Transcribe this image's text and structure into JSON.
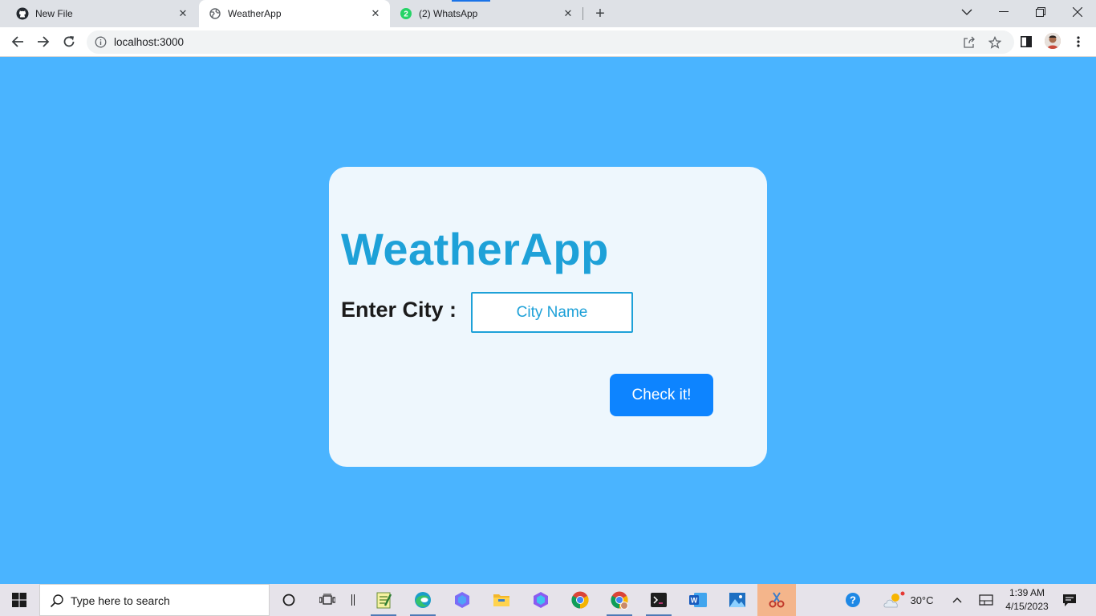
{
  "browser": {
    "tabs": [
      {
        "label": "New File",
        "icon": "github-icon"
      },
      {
        "label": "WeatherApp",
        "icon": "globe-icon",
        "active": true
      },
      {
        "label": "(2) WhatsApp",
        "icon": "whatsapp-icon",
        "badge": "2"
      }
    ],
    "url": "localhost:3000"
  },
  "app": {
    "title": "WeatherApp",
    "city_label": "Enter City :",
    "city_placeholder": "City Name",
    "button_label": "Check it!"
  },
  "taskbar": {
    "search_placeholder": "Type here to search",
    "weather_temp": "30°C",
    "time": "1:39 AM",
    "date": "4/15/2023"
  },
  "colors": {
    "page_bg": "#4ab4ff",
    "card_bg": "#eef7fd",
    "title": "#1ea1d8",
    "button": "#0d84ff"
  }
}
